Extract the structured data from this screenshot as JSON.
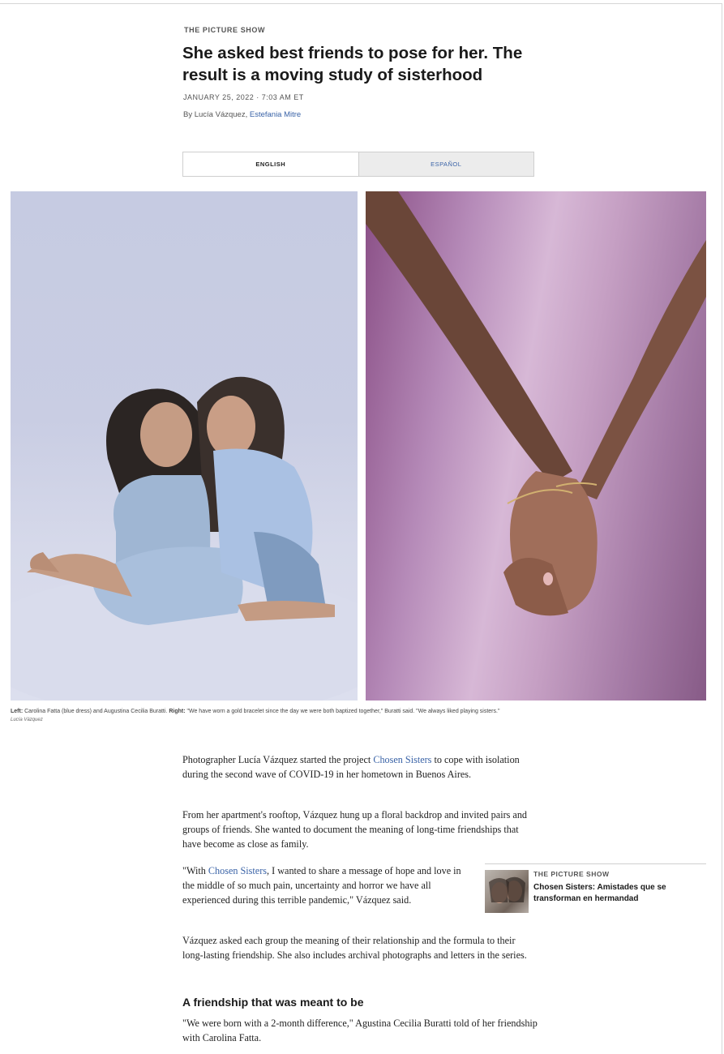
{
  "article": {
    "kicker": "THE PICTURE SHOW",
    "headline": "She asked best friends to pose for her. The result is a moving study of sisterhood",
    "dateline": "JANUARY 25, 2022 · 7:03 AM ET",
    "byline_prefix": "By Lucía Vázquez, ",
    "byline_link": "Estefania Mitre"
  },
  "language_tabs": [
    {
      "label": "ENGLISH",
      "active": true
    },
    {
      "label": "ESPAÑOL",
      "active": false
    }
  ],
  "photos": {
    "left_alt": "Two women sitting on a white backdrop embracing",
    "right_alt": "Two forearms crossed with hands clasped against a pink backdrop",
    "caption_left_label": "Left:",
    "caption_left_text": " Carolina Fatta (blue dress) and Augustina Cecilia Buratti. ",
    "caption_right_label": "Right:",
    "caption_right_text": " \"We have worn a gold bracelet since the day we were both baptized together,\" Buratti said. \"We always liked playing sisters.\"",
    "credit": "Lucía Vázquez"
  },
  "body": {
    "p1_a": "Photographer Lucía Vázquez started the project ",
    "p1_link": "Chosen Sisters",
    "p1_b": " to cope with isolation during the second wave of COVID-19 in her hometown in Buenos Aires.",
    "p2": "From her apartment's rooftop, Vázquez hung up a floral backdrop and invited pairs and groups of friends. She wanted to document the meaning of long-time friendships that have become as close as family.",
    "p3_a": "\"With ",
    "p3_link": "Chosen Sisters",
    "p3_b": ", I wanted to share a message of hope and love in the middle of so much pain, uncertainty and horror we have all experienced during this terrible pandemic,\" Vázquez said.",
    "p4": "Vázquez asked each group the meaning of their relationship and the formula to their long-lasting friendship. She also includes archival photographs and letters in the series.",
    "subhead": "A friendship that was meant to be",
    "p5": "\"We were born with a 2-month difference,\" Agustina Cecilia Buratti told of her friendship with Carolina Fatta."
  },
  "related": {
    "kicker": "THE PICTURE SHOW",
    "title": "Chosen Sisters: Amistades que se transforman en hermandad"
  },
  "colors": {
    "link": "#3a63a7",
    "tab_inactive_bg": "#ececec"
  }
}
